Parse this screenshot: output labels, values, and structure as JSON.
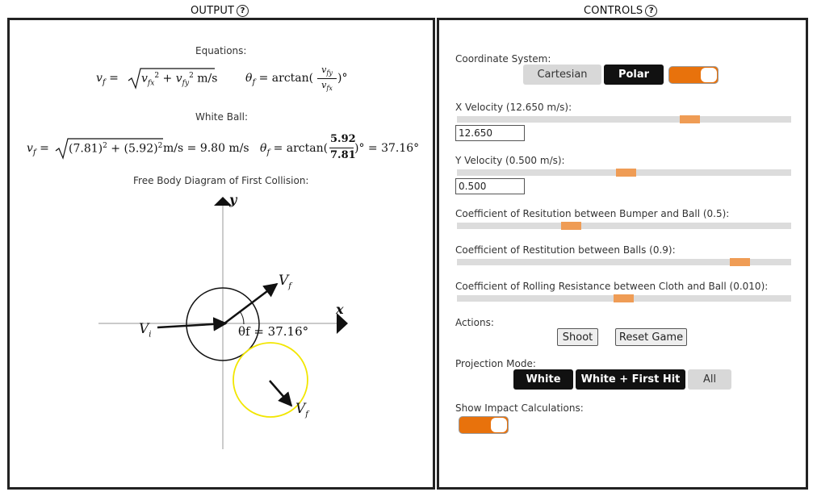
{
  "output_header": {
    "title": "OUTPUT",
    "help": "?"
  },
  "controls_header": {
    "title": "CONTROLS",
    "help": "?"
  },
  "output": {
    "equations_title": "Equations:",
    "white_ball_title": "White Ball:",
    "fbd_title": "Free Body Diagram of First Collision:",
    "eq1": {
      "lhs": "v",
      "sub": "f",
      "unit": "m/s"
    },
    "eq2": {
      "lhs": "θ",
      "sub": "f",
      "fn": "arctan(",
      "num": "v",
      "den": "v",
      "close": ")°"
    },
    "white": {
      "vx": "(7.81)",
      "vy": "(5.92)",
      "speed": "9.80 m/s",
      "num": "5.92",
      "den": "7.81",
      "angle": "37.16°"
    },
    "diagram": {
      "x_axis": "x",
      "y_axis": "y",
      "vi_label": "V",
      "vi_sub": "i",
      "vf_label": "V",
      "vf_sub": "f",
      "vf2_label": "V",
      "vf2_sub": "f",
      "theta_label": "θf = 37.16°",
      "white_ball_color": "#111111",
      "hit_ball_color": "#f2e600"
    }
  },
  "controls": {
    "coord_label": "Coordinate System:",
    "coord_options": [
      "Cartesian",
      "Polar"
    ],
    "coord_selected": "Polar",
    "coord_toggle_on": true,
    "x_velocity_label": "X Velocity (12.650 m/s):",
    "x_velocity_value": "12.650",
    "x_velocity_fraction": 0.68,
    "y_velocity_label": "Y Velocity (0.500 m/s):",
    "y_velocity_value": "0.500",
    "y_velocity_fraction": 0.5,
    "bumper_label": "Coefficient of Resitution between Bumper and Ball (0.5):",
    "bumper_fraction": 0.34,
    "balls_label": "Coefficient of Restitution between Balls (0.9):",
    "balls_fraction": 0.87,
    "rolling_label": "Coefficient of Rolling Resistance between Cloth and Ball (0.010):",
    "rolling_fraction": 0.5,
    "actions_label": "Actions:",
    "shoot_label": "Shoot",
    "reset_label": "Reset Game",
    "projection_label": "Projection Mode:",
    "projection_options": [
      "White",
      "White + First Hit",
      "All"
    ],
    "impact_label": "Show Impact Calculations:",
    "impact_toggle_on": true,
    "accent_color": "#e8720c",
    "thumb_color": "#ef9c55"
  }
}
